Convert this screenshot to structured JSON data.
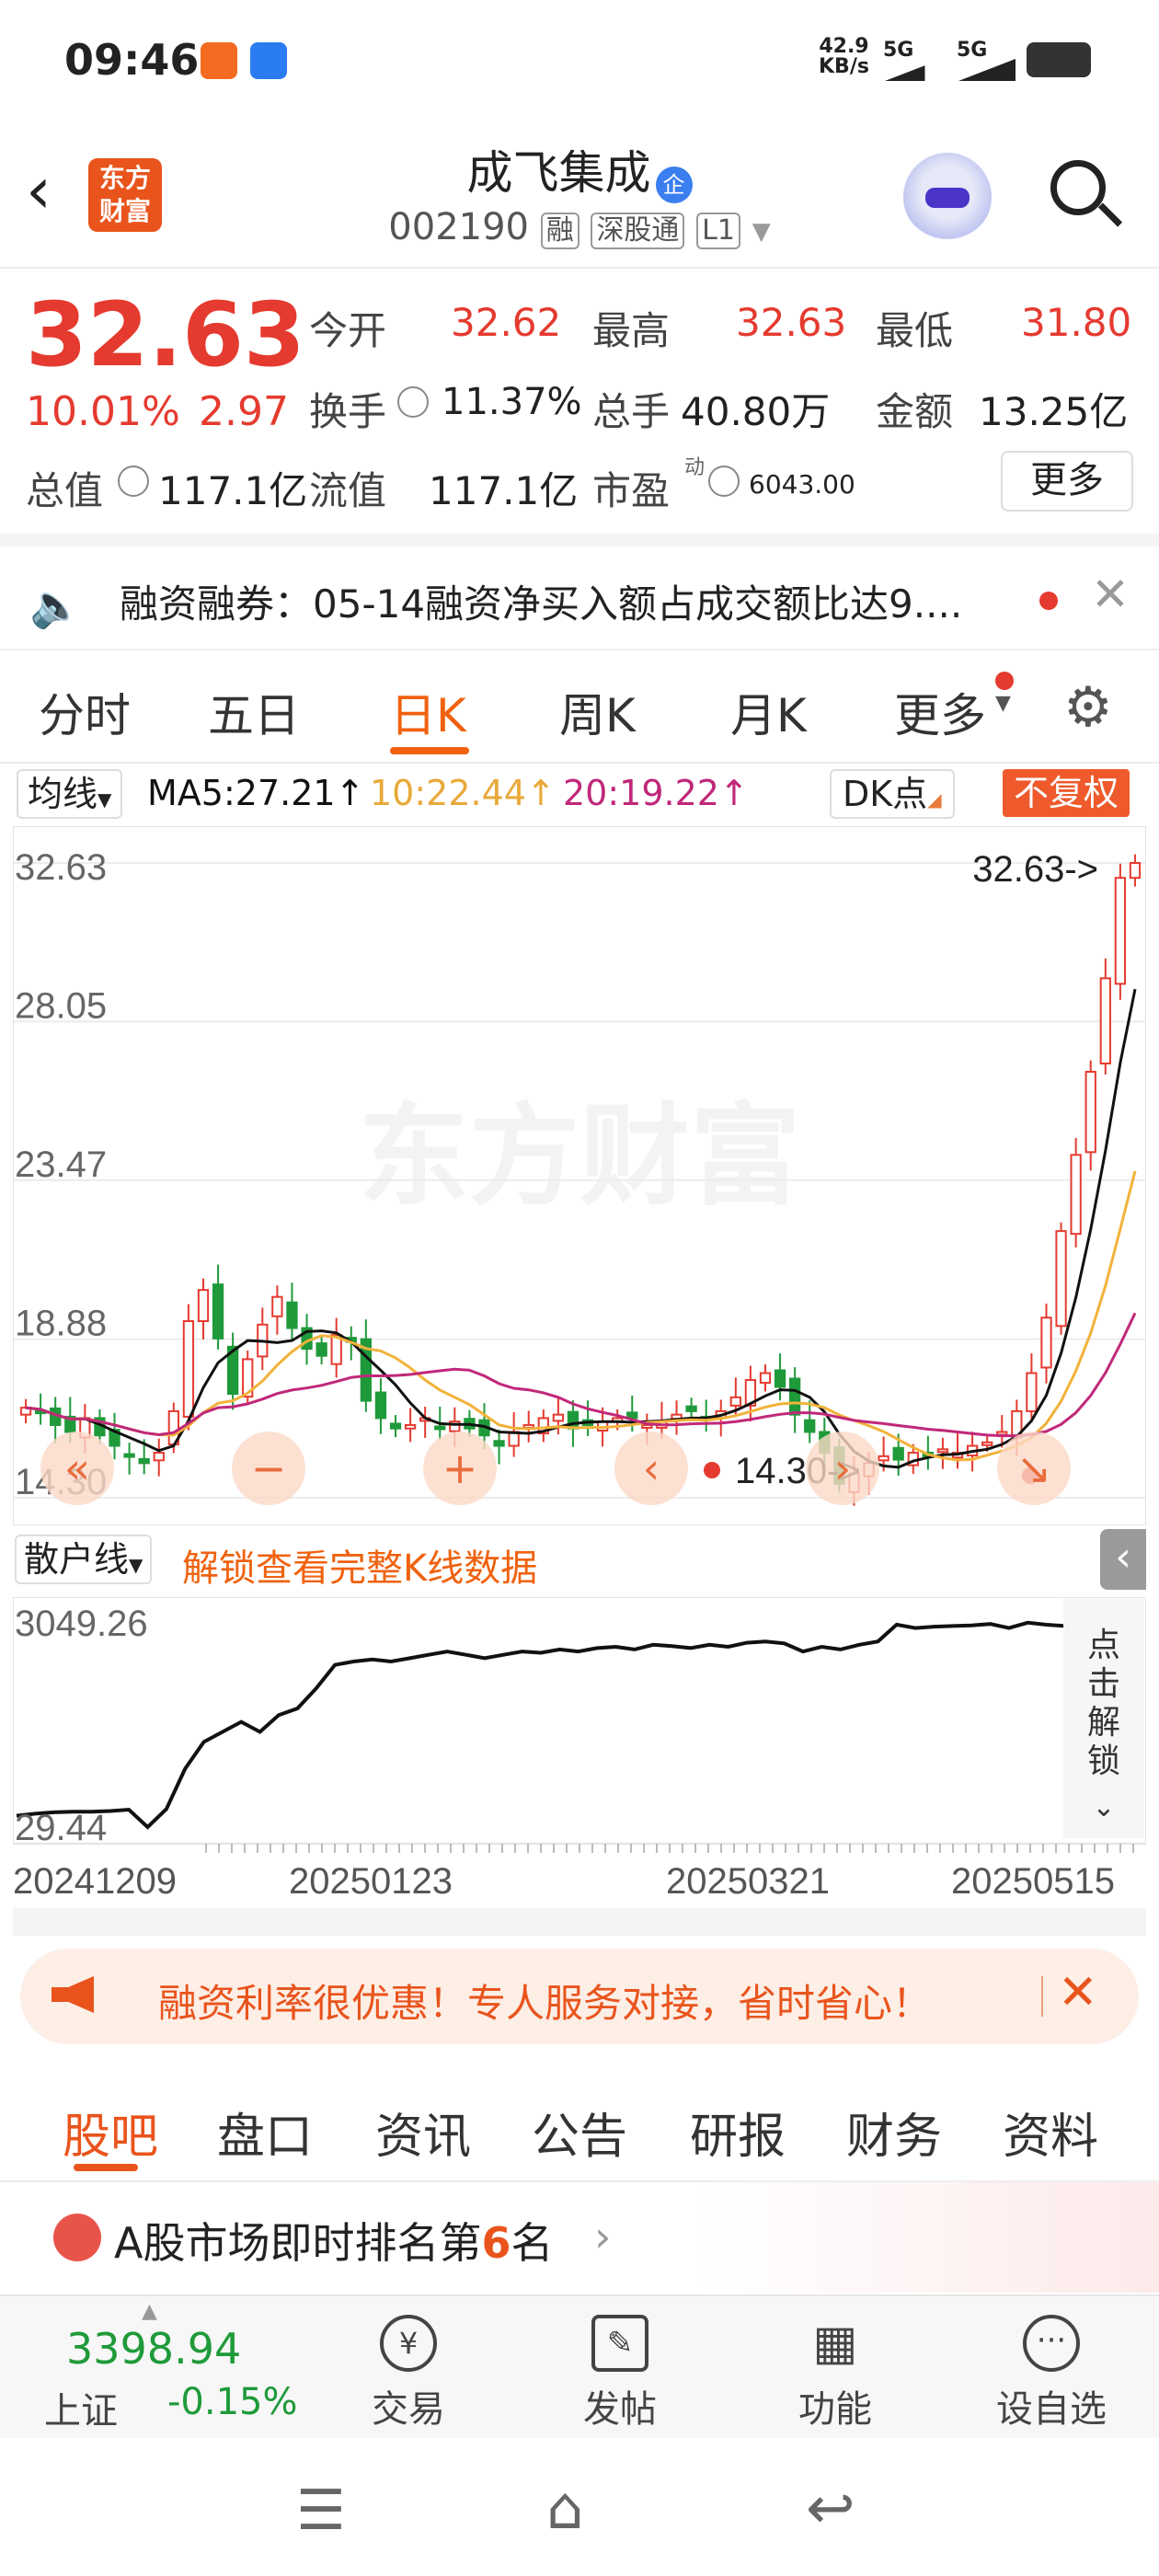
{
  "status": {
    "time": "09:46",
    "net_speed_value": "42.9",
    "net_speed_unit": "KB/s",
    "sim1": "5G",
    "sim2": "5G"
  },
  "header": {
    "name": "成飞集成",
    "name_tag": "企",
    "code": "002190",
    "badges": [
      "融",
      "深股通",
      "L1"
    ],
    "logo_line1": "东方",
    "logo_line2": "财富"
  },
  "quote": {
    "price": "32.63",
    "change_pct": "10.01%",
    "change_abs": "2.97",
    "open_label": "今开",
    "open": "32.62",
    "high_label": "最高",
    "high": "32.63",
    "low_label": "最低",
    "low": "31.80",
    "turnover_label": "换手",
    "turnover": "11.37%",
    "volume_label": "总手",
    "volume": "40.80万",
    "amount_label": "金额",
    "amount": "13.25亿",
    "mktcap_label": "总值",
    "mktcap": "117.1亿",
    "float_label": "流值",
    "float": "117.1亿",
    "pe_label": "市盈",
    "pe_sup": "动",
    "pe": "6043.00",
    "more": "更多"
  },
  "notice": {
    "text": "融资融券：05-14融资净买入额占成交额比达9...."
  },
  "tabs": [
    "分时",
    "五日",
    "日K",
    "周K",
    "月K",
    "更多"
  ],
  "ma_bar": {
    "ma_select": "均线",
    "ma5": "MA5:27.21",
    "ma10": "10:22.44",
    "ma20": "20:19.22",
    "arrow": "↑",
    "dk": "DK点",
    "fq": "不复权"
  },
  "chart_data": [
    {
      "type": "candlestick",
      "y_ticks": [
        "32.63",
        "28.05",
        "23.47",
        "18.88",
        "14.30"
      ],
      "ylim": [
        14.3,
        32.63
      ],
      "last_label": "32.63->",
      "low_label": "14.30->",
      "watermark": "东方财富",
      "series": [
        {
          "name": "MA5",
          "color": "#111111"
        },
        {
          "name": "MA10",
          "color": "#f2b23a"
        },
        {
          "name": "MA20",
          "color": "#c0287a"
        }
      ],
      "candles_close": [
        16.9,
        16.8,
        16.4,
        16.2,
        16.6,
        16.1,
        15.8,
        15.5,
        15.3,
        15.6,
        16.8,
        19.4,
        20.3,
        18.9,
        17.3,
        18.3,
        19.3,
        20.1,
        19.2,
        18.6,
        18.4,
        19.0,
        18.8,
        17.1,
        16.6,
        16.3,
        16.4,
        16.6,
        16.3,
        16.5,
        16.3,
        16.1,
        15.8,
        16.2,
        16.4,
        16.6,
        16.7,
        16.3,
        16.4,
        16.5,
        16.6,
        16.6,
        16.4,
        16.5,
        16.7,
        16.8,
        16.6,
        16.8,
        17.2,
        17.7,
        17.9,
        17.5,
        16.7,
        16.2,
        15.6,
        14.7,
        15.0,
        15.3,
        15.5,
        15.4,
        15.6,
        15.5,
        15.7,
        15.6,
        15.8,
        15.9,
        16.2,
        16.8,
        17.9,
        19.5,
        22.0,
        24.2,
        26.6,
        29.3,
        32.2,
        32.63
      ],
      "dates": [
        "20241209",
        "20250123",
        "20250321",
        "20250515"
      ]
    },
    {
      "type": "line",
      "name": "散户线",
      "y_ticks": [
        "3049.26",
        "29.44"
      ],
      "ylim": [
        29.44,
        3049.26
      ],
      "values": [
        200,
        230,
        250,
        260,
        260,
        270,
        290,
        30,
        300,
        900,
        1300,
        1450,
        1600,
        1450,
        1700,
        1800,
        2100,
        2450,
        2500,
        2530,
        2500,
        2550,
        2600,
        2650,
        2600,
        2550,
        2600,
        2650,
        2630,
        2680,
        2650,
        2700,
        2720,
        2680,
        2750,
        2730,
        2700,
        2750,
        2720,
        2780,
        2800,
        2770,
        2650,
        2720,
        2680,
        2750,
        2800,
        3050,
        3000,
        3020,
        3030,
        3040,
        3060,
        3000,
        3080,
        3049,
        3030
      ],
      "unlock_text": "解锁查看完整K线数据",
      "side_unlock": "点击解锁"
    }
  ],
  "promo": {
    "text": "融资利率很优惠！专人服务对接，省时省心！"
  },
  "bottom_tabs": [
    "股吧",
    "盘口",
    "资讯",
    "公告",
    "研报",
    "财务",
    "资料"
  ],
  "rank": {
    "prefix": "A股市场即时排名第",
    "num": "6",
    "suffix": "名"
  },
  "bottombar": {
    "index_value": "3398.94",
    "index_name": "上证",
    "index_change": "-0.15%",
    "items": [
      "交易",
      "发帖",
      "功能",
      "设自选"
    ]
  },
  "colors": {
    "up": "#e53a2f",
    "down": "#1f9a3a",
    "accent": "#f0620f"
  }
}
